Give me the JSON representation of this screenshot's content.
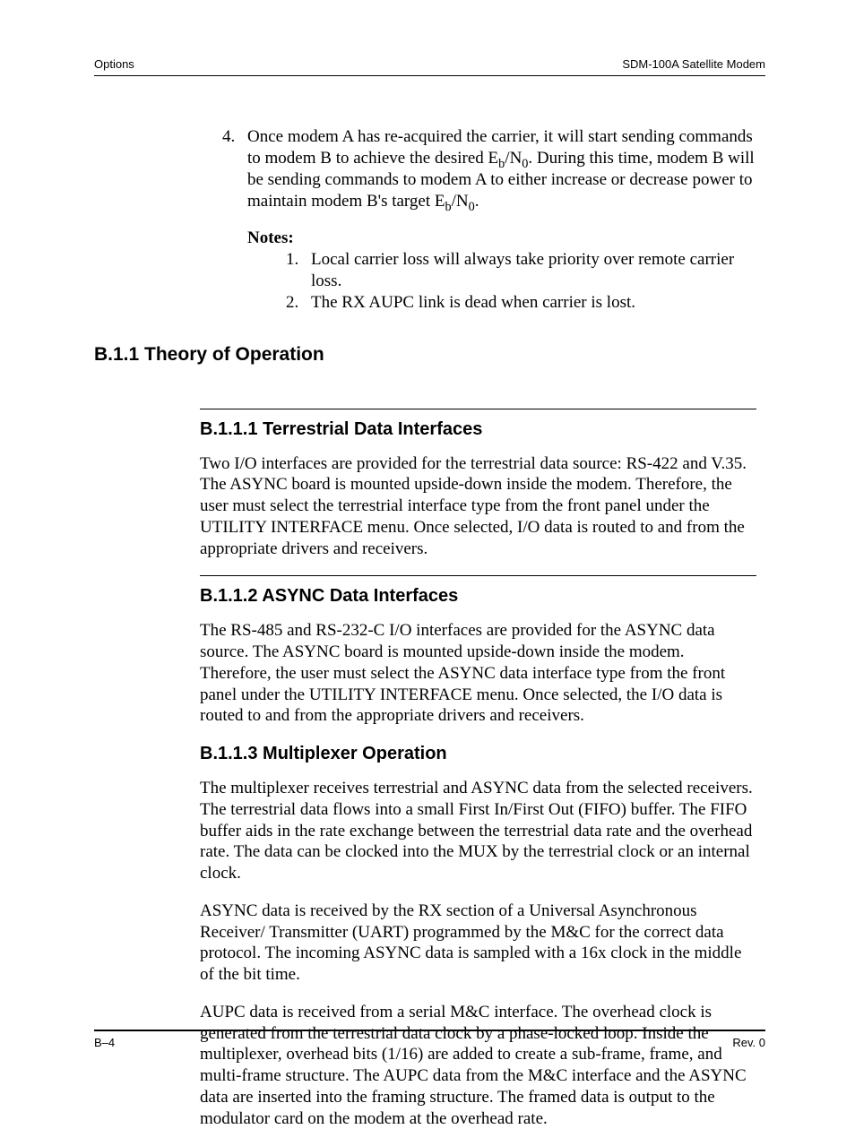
{
  "header": {
    "left": "Options",
    "right": "SDM-100A Satellite Modem"
  },
  "item4": {
    "num": "4.",
    "text_html": "Once modem A has re-acquired the carrier, it will start sending commands to modem B to achieve the desired E<span class=\"sub\">b</span>/N<span class=\"sub\">0</span>. During this time, modem B will be sending commands to modem A to either increase or decrease power to maintain modem B's target E<span class=\"sub\">b</span>/N<span class=\"sub\">0</span>."
  },
  "notes": {
    "label": "Notes:",
    "items": [
      {
        "n": "1.",
        "t": "Local carrier loss will always take priority over remote carrier loss."
      },
      {
        "n": "2.",
        "t": "The RX AUPC link is dead when carrier is lost."
      }
    ]
  },
  "sec_b11": "B.1.1  Theory of Operation",
  "sub1": {
    "title": "B.1.1.1  Terrestrial Data Interfaces",
    "p1": "Two I/O interfaces are provided for the terrestrial data source: RS-422 and V.35. The ASYNC board is mounted upside-down inside the modem. Therefore, the user must select the terrestrial interface type from the front panel under the UTILITY INTERFACE menu. Once selected, I/O data is routed to and from the appropriate drivers and receivers."
  },
  "sub2": {
    "title": "B.1.1.2  ASYNC Data Interfaces",
    "p1": "The RS-485 and RS-232-C I/O interfaces are provided for the ASYNC data source. The ASYNC board is mounted upside-down inside the modem. Therefore, the user must select the ASYNC data interface type from the front panel under the UTILITY INTERFACE menu. Once selected, the I/O data is routed to and from the appropriate drivers and receivers."
  },
  "sub3": {
    "title": "B.1.1.3  Multiplexer Operation",
    "p1": "The multiplexer receives terrestrial and ASYNC data from the selected receivers. The terrestrial data flows into a small First In/First Out (FIFO) buffer. The FIFO buffer aids in the rate exchange between the terrestrial data rate and the overhead rate. The data can be clocked into the MUX by the terrestrial clock or an internal clock.",
    "p2": "ASYNC data is received by the RX section of a Universal Asynchronous Receiver/ Transmitter (UART) programmed by the M&C for the correct data protocol. The incoming ASYNC data is sampled with a 16x clock in the middle of the bit time.",
    "p3": "AUPC data is received from a serial M&C interface. The overhead clock is generated from the terrestrial data clock by a phase-locked loop. Inside the multiplexer, overhead bits (1/16) are added to create a sub-frame, frame, and multi-frame structure. The AUPC data from the M&C interface and the ASYNC data are inserted into the framing structure. The framed data is output to the modulator card on the modem at the overhead rate."
  },
  "footer": {
    "left": "B–4",
    "right": "Rev. 0"
  }
}
